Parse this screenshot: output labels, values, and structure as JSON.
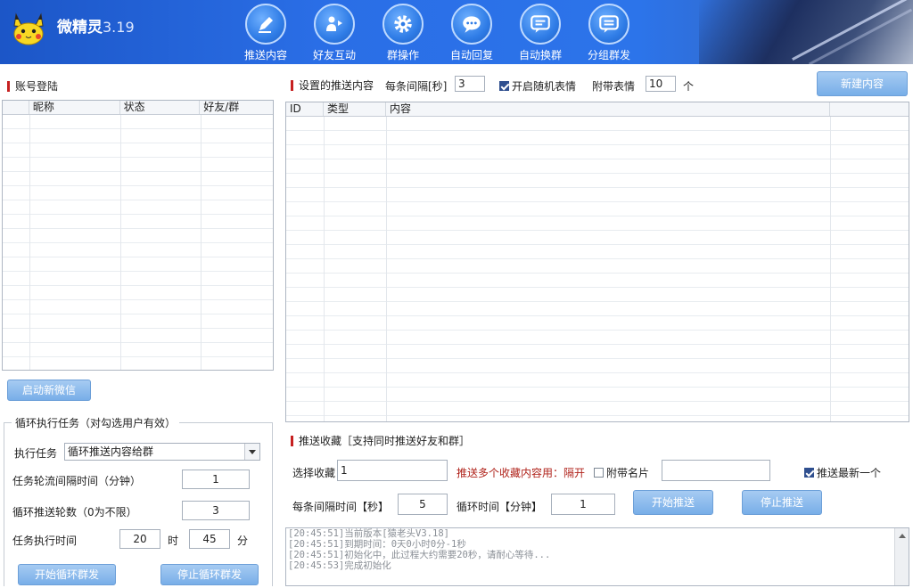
{
  "header": {
    "app_name": "微精灵",
    "version": "3.19",
    "nav": [
      {
        "label": "推送内容",
        "icon": "pen-icon"
      },
      {
        "label": "好友互动",
        "icon": "user-interact-icon"
      },
      {
        "label": "群操作",
        "icon": "gear-icon"
      },
      {
        "label": "自动回复",
        "icon": "chat-icon"
      },
      {
        "label": "自动换群",
        "icon": "chat-swap-icon"
      },
      {
        "label": "分组群发",
        "icon": "chat-group-icon"
      }
    ]
  },
  "account": {
    "title": "账号登陆",
    "columns": [
      "昵称",
      "状态",
      "好友/群"
    ],
    "start_button": "启动新微信"
  },
  "loop": {
    "group_title": "循环执行任务（对勾选用户有效）",
    "task_label": "执行任务",
    "task_value": "循环推送内容给群",
    "interval_label": "任务轮流间隔时间（分钟）",
    "interval_value": "1",
    "rounds_label": "循环推送轮数（0为不限）",
    "rounds_value": "3",
    "time_label": "任务执行时间",
    "hour_value": "20",
    "hour_unit": "时",
    "minute_value": "45",
    "minute_unit": "分",
    "start_button": "开始循环群发",
    "stop_button": "停止循环群发"
  },
  "content": {
    "title": "设置的推送内容",
    "interval_label": "每条间隔[秒]",
    "interval_value": "3",
    "random_emoji_label": "开启随机表情",
    "emoji_label": "附带表情",
    "emoji_count": "10",
    "emoji_unit": "个",
    "new_button": "新建内容",
    "columns": [
      "ID",
      "类型",
      "内容"
    ]
  },
  "favorites": {
    "title": "推送收藏［支持同时推送好友和群］",
    "select_label": "选择收藏",
    "select_value": "1",
    "hint": "推送多个收藏内容用：隔开",
    "card_label": "附带名片",
    "latest_label": "推送最新一个",
    "interval_label": "每条间隔时间【秒】",
    "interval_value": "5",
    "cycle_label": "循环时间【分钟】",
    "cycle_value": "1",
    "start_button": "开始推送",
    "stop_button": "停止推送"
  },
  "log": [
    "[20:45:51]当前版本[猿老头V3.18]",
    "[20:45:51]到期时间：0天0小时0分-1秒",
    "[20:45:51]初始化中，此过程大约需要20秒，请耐心等待...",
    "[20:45:53]完成初始化"
  ]
}
